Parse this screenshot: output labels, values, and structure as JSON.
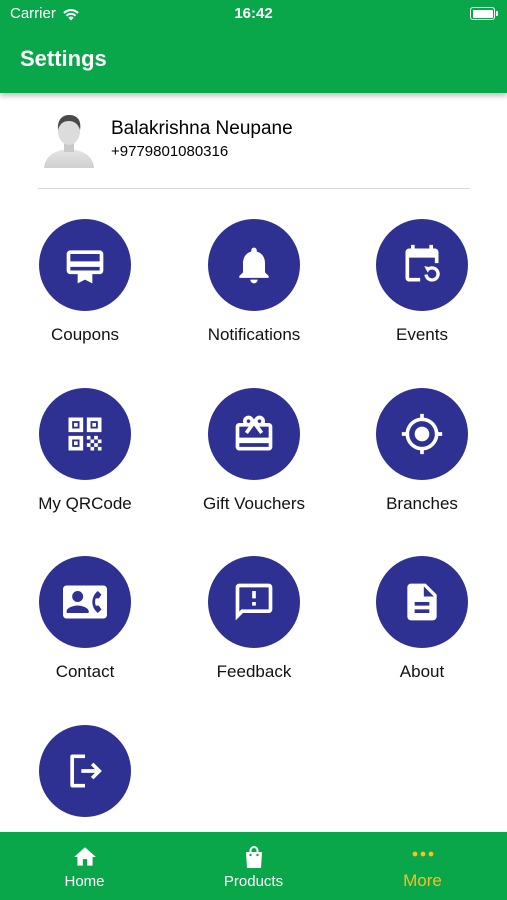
{
  "status_bar": {
    "carrier": "Carrier",
    "time": "16:42"
  },
  "header": {
    "title": "Settings"
  },
  "profile": {
    "name": "Balakrishna Neupane",
    "phone": "+9779801080316"
  },
  "menu": [
    {
      "label": "Coupons",
      "icon": "coupon-icon"
    },
    {
      "label": "Notifications",
      "icon": "bell-icon"
    },
    {
      "label": "Events",
      "icon": "calendar-sync-icon"
    },
    {
      "label": "My QRCode",
      "icon": "qrcode-icon"
    },
    {
      "label": "Gift Vouchers",
      "icon": "gift-card-icon"
    },
    {
      "label": "Branches",
      "icon": "location-target-icon"
    },
    {
      "label": "Contact",
      "icon": "contact-card-icon"
    },
    {
      "label": "Feedback",
      "icon": "feedback-icon"
    },
    {
      "label": "About",
      "icon": "document-icon"
    },
    {
      "label": "",
      "icon": "logout-icon"
    }
  ],
  "bottom_nav": [
    {
      "label": "Home",
      "icon": "home-icon",
      "active": false
    },
    {
      "label": "Products",
      "icon": "shopping-bag-icon",
      "active": false
    },
    {
      "label": "More",
      "icon": "more-dots-icon",
      "active": true
    }
  ],
  "colors": {
    "primary_green": "#0aa64a",
    "icon_circle": "#2e3192",
    "active_nav": "#f6c026"
  }
}
